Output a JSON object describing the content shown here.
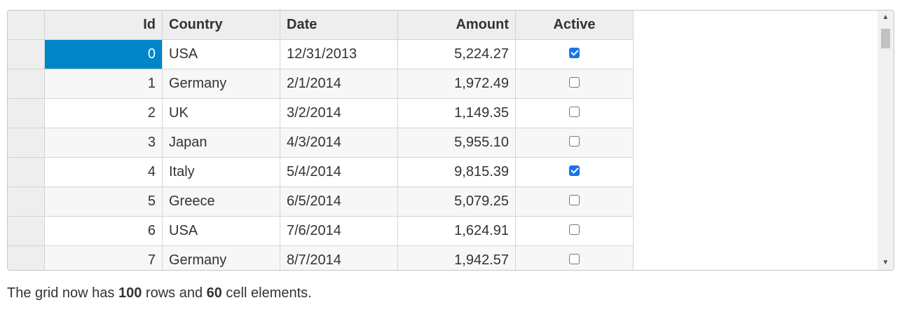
{
  "grid": {
    "columns": [
      "Id",
      "Country",
      "Date",
      "Amount",
      "Active"
    ],
    "rows": [
      {
        "id": "0",
        "country": "USA",
        "date": "12/31/2013",
        "amount": "5,224.27",
        "active": true
      },
      {
        "id": "1",
        "country": "Germany",
        "date": "2/1/2014",
        "amount": "1,972.49",
        "active": false
      },
      {
        "id": "2",
        "country": "UK",
        "date": "3/2/2014",
        "amount": "1,149.35",
        "active": false
      },
      {
        "id": "3",
        "country": "Japan",
        "date": "4/3/2014",
        "amount": "5,955.10",
        "active": false
      },
      {
        "id": "4",
        "country": "Italy",
        "date": "5/4/2014",
        "amount": "9,815.39",
        "active": true
      },
      {
        "id": "5",
        "country": "Greece",
        "date": "6/5/2014",
        "amount": "5,079.25",
        "active": false
      },
      {
        "id": "6",
        "country": "USA",
        "date": "7/6/2014",
        "amount": "1,624.91",
        "active": false
      },
      {
        "id": "7",
        "country": "Germany",
        "date": "8/7/2014",
        "amount": "1,942.57",
        "active": false
      }
    ],
    "selected_row": 0,
    "scrollbar": {
      "up_icon": "triangle-up-icon",
      "down_icon": "triangle-down-icon"
    }
  },
  "footer": {
    "prefix": "The grid now has ",
    "rows_count": "100",
    "middle": " rows and ",
    "cells_count": "60",
    "suffix": " cell elements."
  },
  "colors": {
    "selection": "#0085c7",
    "header": "#eeeeee",
    "checkbox": "#1a73e8"
  }
}
